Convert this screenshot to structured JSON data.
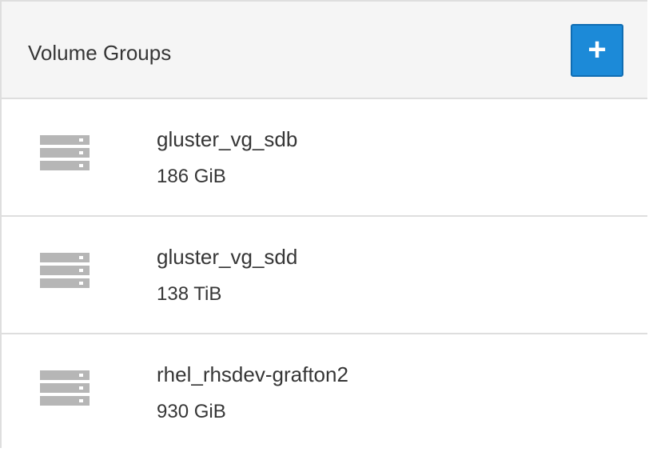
{
  "panel": {
    "title": "Volume Groups",
    "add_label": "+"
  },
  "volume_groups": [
    {
      "name": "gluster_vg_sdb",
      "size": "186 GiB"
    },
    {
      "name": "gluster_vg_sdd",
      "size": "138 TiB"
    },
    {
      "name": "rhel_rhsdev-grafton2",
      "size": "930 GiB"
    }
  ],
  "colors": {
    "accent": "#1c8ad8",
    "heading_bg": "#f5f5f5",
    "border": "#dedede",
    "icon": "#b6b6b6",
    "text": "#363636"
  },
  "icons": {
    "volume_group": "volume-group-icon",
    "add": "plus-icon"
  }
}
